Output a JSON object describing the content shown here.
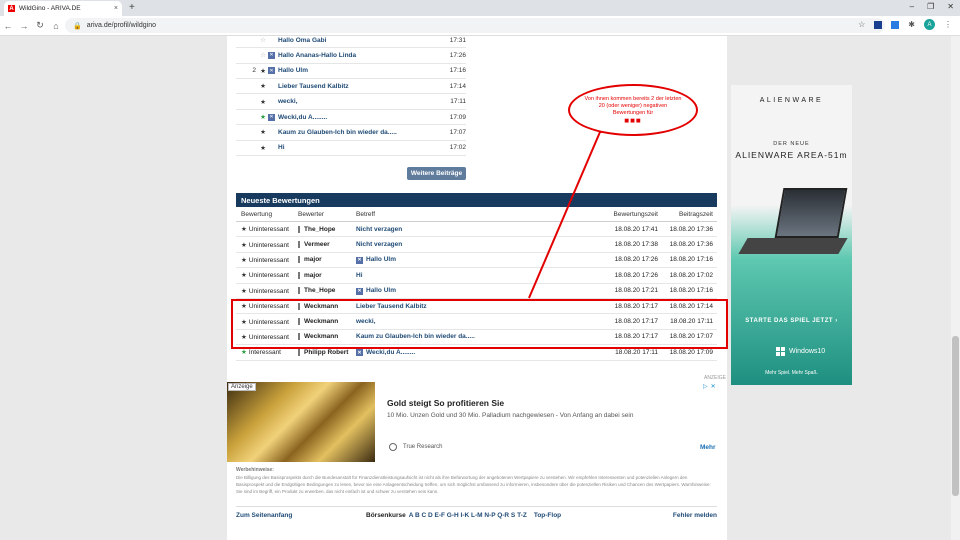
{
  "browser": {
    "tab_title": "WildGino - ARIVA.DE",
    "favicon_letter": "A",
    "tab_close": "×",
    "new_tab": "+",
    "url": "ariva.de/profil/wildgino",
    "avatar_letter": "A",
    "window_controls": [
      "–",
      "❐",
      "✕"
    ]
  },
  "posts": [
    {
      "index": "",
      "star": "empty",
      "icon": false,
      "title": "Hallo Oma Gabi",
      "time": "17:31"
    },
    {
      "index": "",
      "star": "empty",
      "icon": true,
      "title": "Hallo Ananas-Hallo Linda",
      "time": "17:26"
    },
    {
      "index": "2",
      "star": "full",
      "icon": true,
      "title": "Hallo Ulm",
      "time": "17:16"
    },
    {
      "index": "",
      "star": "full",
      "icon": false,
      "title": "Lieber Tausend Kalbitz",
      "time": "17:14"
    },
    {
      "index": "",
      "star": "full",
      "icon": false,
      "title": "wecki,",
      "time": "17:11"
    },
    {
      "index": "",
      "star": "green",
      "icon": true,
      "title": "Wecki,du A........",
      "time": "17:09"
    },
    {
      "index": "",
      "star": "full",
      "icon": false,
      "title": "Kaum zu Glauben-Ich bin wieder da.....",
      "time": "17:07"
    },
    {
      "index": "",
      "star": "full",
      "icon": false,
      "title": "Hi",
      "time": "17:02"
    }
  ],
  "more_posts_label": "Weitere Beiträge",
  "ratings": {
    "title": "Neueste Bewertungen",
    "columns": [
      "Bewertung",
      "Bewerter",
      "Betreff",
      "Bewertungszeit",
      "Beitragszeit"
    ],
    "rows": [
      {
        "rating": "Uninteressant",
        "star": "full",
        "rater": "The_Hope",
        "icon": false,
        "subject": "Nicht verzagen",
        "rated_at": "18.08.20 17:41",
        "posted_at": "18.08.20 17:36"
      },
      {
        "rating": "Uninteressant",
        "star": "full",
        "rater": "Vermeer",
        "icon": false,
        "subject": "Nicht verzagen",
        "rated_at": "18.08.20 17:38",
        "posted_at": "18.08.20 17:36"
      },
      {
        "rating": "Uninteressant",
        "star": "full",
        "rater": "major",
        "icon": true,
        "subject": "Hallo Ulm",
        "rated_at": "18.08.20 17:26",
        "posted_at": "18.08.20 17:16"
      },
      {
        "rating": "Uninteressant",
        "star": "full",
        "rater": "major",
        "icon": false,
        "subject": "Hi",
        "rated_at": "18.08.20 17:26",
        "posted_at": "18.08.20 17:02"
      },
      {
        "rating": "Uninteressant",
        "star": "full",
        "rater": "The_Hope",
        "icon": true,
        "subject": "Hallo Ulm",
        "rated_at": "18.08.20 17:21",
        "posted_at": "18.08.20 17:16"
      },
      {
        "rating": "Uninteressant",
        "star": "full",
        "rater": "Weckmann",
        "icon": false,
        "subject": "Lieber Tausend Kalbitz",
        "rated_at": "18.08.20 17:17",
        "posted_at": "18.08.20 17:14"
      },
      {
        "rating": "Uninteressant",
        "star": "full",
        "rater": "Weckmann",
        "icon": false,
        "subject": "wecki,",
        "rated_at": "18.08.20 17:17",
        "posted_at": "18.08.20 17:11"
      },
      {
        "rating": "Uninteressant",
        "star": "full",
        "rater": "Weckmann",
        "icon": false,
        "subject": "Kaum zu Glauben-Ich bin wieder da.....",
        "rated_at": "18.08.20 17:17",
        "posted_at": "18.08.20 17:07"
      },
      {
        "rating": "Interessant",
        "star": "green",
        "rater": "Philipp Robert",
        "icon": true,
        "subject": "Wecki,du A........",
        "rated_at": "18.08.20 17:11",
        "posted_at": "18.08.20 17:09"
      }
    ]
  },
  "annotation": {
    "text": "Von ihnen kommen bereits 2 der letzten 20 (oder weniger) negativen Bewertungen für",
    "dots": "■■■",
    "color": "#e30000"
  },
  "ad": {
    "label": "ANZEIGE",
    "tag": "Anzeige",
    "title": "Gold steigt So profitieren Sie",
    "subtitle": "10 Mio. Unzen Gold und 30 Mio. Palladium nachgewiesen - Von Anfang an dabei sein",
    "source": "True Research",
    "more": "Mehr",
    "corner": [
      "▷",
      "✕"
    ]
  },
  "warning": {
    "title": "Werbehinweise:",
    "text": "Die Billigung des Basisprospekts durch die Bundesanstalt für Finanzdienstleistungsaufsicht ist nicht als ihre Befürwortung der angebotenen Wertpapiere zu verstehen. Wir empfehlen Interessenten und potenziellen Anlegern den Basisprospekt und die Endgültigen Bedingungen zu lesen, bevor sie eine Anlageentscheidung treffen, um sich möglichst umfassend zu informieren, insbesondere über die potenziellen Risiken und Chancen des Wertpapiers. Warnhinweise: Sie sind im Begriff, ein Produkt zu erwerben, das nicht einfach ist und schwer zu verstehen sein kann."
  },
  "footer": {
    "top_link": "Zum Seitenanfang",
    "kurse_label": "Börsenkurse",
    "letters": "A B C D E-F G-H I-K L-M N-P Q-R S T-Z",
    "flop": "Top-Flop",
    "error_link": "Fehler melden"
  },
  "side_ad": {
    "brand": "ALIENWARE",
    "der_neue": "DER NEUE",
    "model": "ALIENWARE AREA-51m",
    "cta": "STARTE DAS SPIEL JETZT ›",
    "windows": "Windows10",
    "slogan": "Mehr Spiel. Mehr Spaß."
  }
}
